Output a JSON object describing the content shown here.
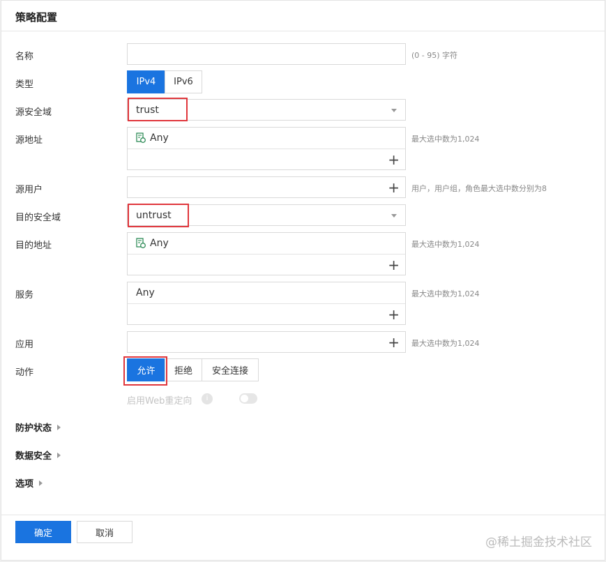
{
  "header": {
    "title": "策略配置"
  },
  "form": {
    "name": {
      "label": "名称",
      "value": "",
      "hint": "(0 - 95) 字符"
    },
    "type": {
      "label": "类型",
      "options": [
        "IPv4",
        "IPv6"
      ],
      "selected": "IPv4"
    },
    "src_zone": {
      "label": "源安全域",
      "value": "trust"
    },
    "src_addr": {
      "label": "源地址",
      "item": "Any",
      "hint": "最大选中数为1,024"
    },
    "src_user": {
      "label": "源用户",
      "hint": "用户，用户组，角色最大选中数分别为8"
    },
    "dst_zone": {
      "label": "目的安全域",
      "value": "untrust"
    },
    "dst_addr": {
      "label": "目的地址",
      "item": "Any",
      "hint": "最大选中数为1,024"
    },
    "service": {
      "label": "服务",
      "item": "Any",
      "hint": "最大选中数为1,024"
    },
    "app": {
      "label": "应用",
      "hint": "最大选中数为1,024"
    },
    "action": {
      "label": "动作",
      "options": [
        "允许",
        "拒绝",
        "安全连接"
      ],
      "selected": "允许"
    },
    "web_redirect": {
      "label": "启用Web重定向",
      "enabled": false
    }
  },
  "sections": [
    "防护状态",
    "数据安全",
    "选项"
  ],
  "footer": {
    "confirm": "确定",
    "cancel": "取消"
  },
  "watermark": "@稀土掘金技术社区",
  "colors": {
    "primary": "#1a74e0",
    "highlight": "#e0353b"
  }
}
